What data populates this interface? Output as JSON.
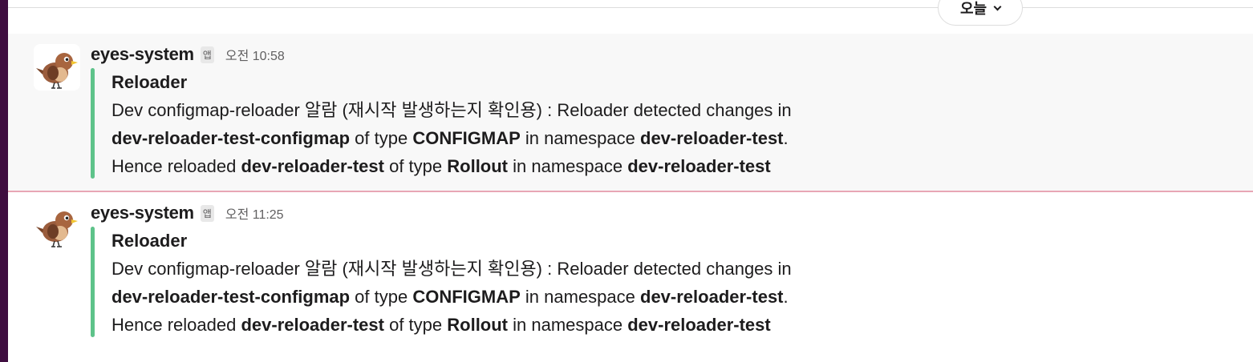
{
  "date_divider": {
    "label": "오늘"
  },
  "messages": [
    {
      "sender": "eyes-system",
      "badge": "앱",
      "time": "오전 10:58",
      "attachment": {
        "title": "Reloader",
        "line1": "Dev configmap-reloader 알람 (재시작 발생하는지 확인용) : Reloader detected changes in",
        "configmap": "dev-reloader-test-configmap",
        "of_type": " of type ",
        "type1": "CONFIGMAP",
        "in_ns": " in namespace ",
        "ns1": "dev-reloader-test",
        "period": ".",
        "hence": "Hence reloaded ",
        "target": "dev-reloader-test",
        "of_type2": " of type ",
        "type2": "Rollout",
        "in_ns2": " in namespace ",
        "ns2": "dev-reloader-test"
      }
    },
    {
      "sender": "eyes-system",
      "badge": "앱",
      "time": "오전 11:25",
      "attachment": {
        "title": "Reloader",
        "line1": "Dev configmap-reloader 알람 (재시작 발생하는지 확인용) : Reloader detected changes in",
        "configmap": "dev-reloader-test-configmap",
        "of_type": " of type ",
        "type1": "CONFIGMAP",
        "in_ns": " in namespace ",
        "ns1": "dev-reloader-test",
        "period": ".",
        "hence": "Hence reloaded ",
        "target": "dev-reloader-test",
        "of_type2": " of type ",
        "type2": "Rollout",
        "in_ns2": " in namespace ",
        "ns2": "dev-reloader-test"
      }
    }
  ],
  "colors": {
    "sidebar": "#3f0e40",
    "attachment_bar": "#5ec38a",
    "new_message_line": "#e8a6b5",
    "hover_bg": "#f8f8f8"
  }
}
